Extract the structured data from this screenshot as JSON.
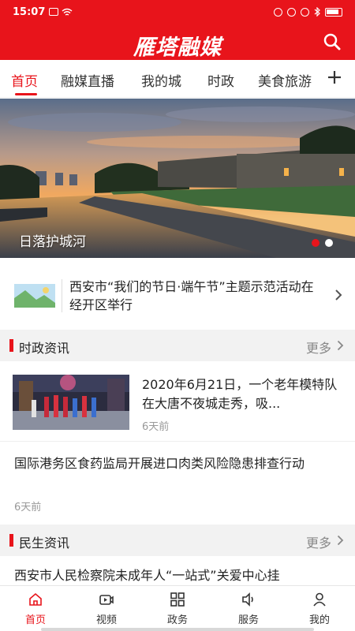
{
  "status_bar": {
    "time": "15:07",
    "battery": "battery-icon",
    "icons": [
      "notification-icon",
      "wifi-icon",
      "nfc-icon",
      "alarm-icon",
      "location-icon",
      "bluetooth-icon"
    ]
  },
  "header": {
    "app_title": "雁塔融媒",
    "search_icon": "search-icon"
  },
  "tabs": {
    "items": [
      {
        "label": "首页",
        "active": true
      },
      {
        "label": "融媒直播",
        "active": false
      },
      {
        "label": "我的城",
        "active": false
      },
      {
        "label": "时政",
        "active": false
      },
      {
        "label": "美食旅游",
        "active": false
      }
    ],
    "add_icon": "plus-icon"
  },
  "banner": {
    "caption": "日落护城河",
    "slide_count": 2,
    "active_slide": 1
  },
  "featured": {
    "text": "西安市“我们的节日·端午节”主题示范活动在经开区举行",
    "chevron_icon": "chevron-right-icon"
  },
  "sections": [
    {
      "title": "时政资讯",
      "more": "更多"
    },
    {
      "title": "民生资讯",
      "more": "更多"
    }
  ],
  "news": [
    {
      "title": "2020年6月21日，一个老年模特队在大唐不夜城走秀，吸...",
      "time": "6天前"
    },
    {
      "title": "国际港务区食药监局开展进口肉类风险隐患排查行动",
      "time": "6天前"
    },
    {
      "title": "西安市人民检察院未成年人“一站式”关爱中心挂"
    }
  ],
  "bottom_nav": {
    "items": [
      {
        "label": "首页",
        "icon": "home-icon",
        "active": true
      },
      {
        "label": "视频",
        "icon": "video-icon",
        "active": false
      },
      {
        "label": "政务",
        "icon": "grid-icon",
        "active": false
      },
      {
        "label": "服务",
        "icon": "speaker-icon",
        "active": false
      },
      {
        "label": "我的",
        "icon": "user-icon",
        "active": false
      }
    ]
  },
  "colors": {
    "brand_red": "#e8141b",
    "section_bg": "#f2f2f2",
    "muted_text": "#999999"
  }
}
